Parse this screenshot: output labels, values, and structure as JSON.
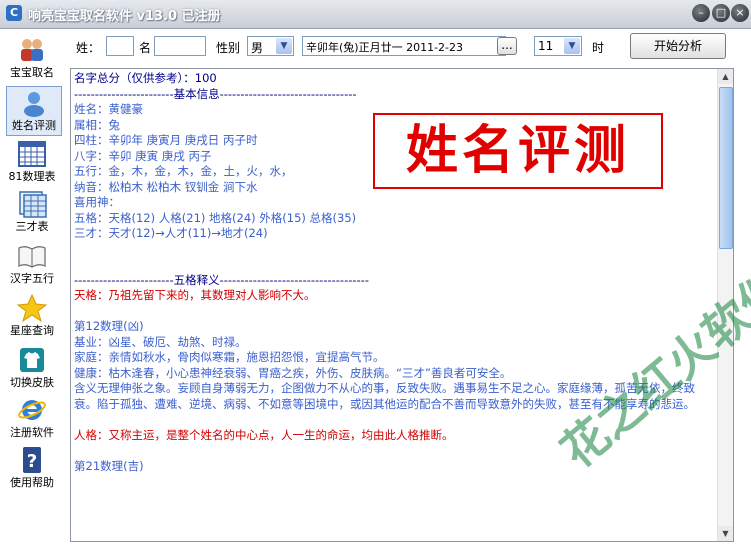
{
  "window": {
    "title": "响亮宝宝取名软件 v13.0  已注册"
  },
  "sidebar": {
    "items": [
      {
        "label": "宝宝取名",
        "icon": "people-icon"
      },
      {
        "label": "姓名评测",
        "icon": "user-icon",
        "active": true
      },
      {
        "label": "81数理表",
        "icon": "calendar-grid-icon"
      },
      {
        "label": "三才表",
        "icon": "table-icon"
      },
      {
        "label": "汉字五行",
        "icon": "book-icon"
      },
      {
        "label": "星座查询",
        "icon": "star-icon"
      },
      {
        "label": "切换皮肤",
        "icon": "shirt-icon"
      },
      {
        "label": "注册软件",
        "icon": "ie-icon"
      },
      {
        "label": "使用帮助",
        "icon": "help-icon"
      }
    ]
  },
  "form": {
    "surname_label": "姓：",
    "name_label": "名",
    "gender_label": "性别",
    "gender_value": "男",
    "date_value": "辛卯年(兔)正月廿一  2011-2-23",
    "date_button": "...",
    "hour_value": "11",
    "hour_label": "时",
    "analyze_button": "开始分析"
  },
  "result": {
    "total_score": "名字总分（仅供参考）：100",
    "basic_header": "------------------------基本信息---------------------------------",
    "name": "姓名：黄健豪",
    "zodiac": "属相：兔",
    "sizhu": "四柱：辛卯年 庚寅月 庚戌日 丙子时",
    "bazi": "八字：辛卯 庚寅 庚戌 丙子",
    "wuxing": "五行：金，木，金，木，金，土，火，水，",
    "nayin": "纳音：松柏木 松柏木 钗钏金 涧下水",
    "xiyong": "喜用神：",
    "wuge": "五格：天格(12) 人格(21) 地格(24) 外格(15) 总格(35)",
    "sancai": "三才：天才(12)→人才(11)→地才(24)",
    "wuge_header": "------------------------五格释义------------------------------------",
    "tiange_title": "天格：乃祖先留下来的，其数理对人影响不大。",
    "num12_title": "第12数理(凶)",
    "num12_basic": "基业：凶星、破厄、劫煞、时禄。",
    "num12_family": "家庭：亲情如秋水，骨肉似寒霜，施恩招怨恨，宜提高气节。",
    "num12_health": "健康：枯木逢春，小心患神经衰弱、胃癌之疾，外伤、皮肤病。“三才”善良者可安全。",
    "num12_meaning1": "含义无理伸张之象。妄顾自身薄弱无力，企图做力不从心的事，反致失败。遇事易生不足之心。家庭缘薄，孤苦无依，终致",
    "num12_meaning2": "衰。陷于孤独、遭难、逆境、病弱、不如意等困境中，或因其他运的配合不善而导致意外的失败，甚至有不能享寿的悲运。",
    "renge_title": "人格：又称主运，是整个姓名的中心点，人一生的命运，均由此人格推断。",
    "num21_title": "第21数理(吉)"
  },
  "stamp": {
    "text": "姓名评测"
  },
  "watermark": {
    "text": "花之红火软件"
  },
  "colors": {
    "accent_red": "#e00000",
    "text_blue": "#3a5fcd",
    "title_red": "#d20000"
  }
}
